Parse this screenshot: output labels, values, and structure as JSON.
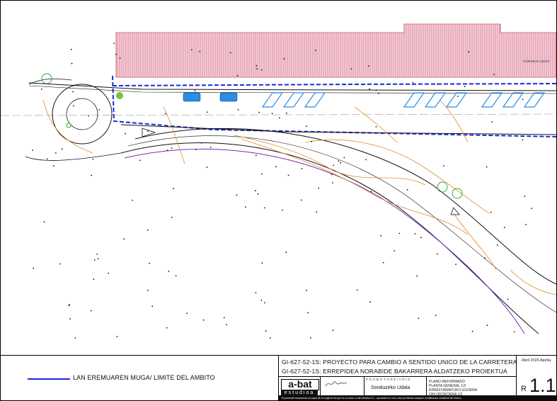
{
  "plan": {
    "building_label": "3 ERAIKIN AZKOT",
    "trees": [
      "tree",
      "tree",
      "tree",
      "tree",
      "tree"
    ]
  },
  "legend": {
    "label": "LAN EREMUAREN MUGA/ LIMITE DEL AMBITO",
    "line_color": "#1a2bd8"
  },
  "titleblock": {
    "title_es": "GI-627-52-1S: PROYECTO  PARA CAMBIO A SENTIDO UNICO DE LA CARRETERA",
    "title_eu": "GI-627-52-1S:  ERREPIDEA NORABIDE BAKARRERA ALDATZEKO  PROIEKTUA",
    "logo_main": "a-bat",
    "logo_sub": "estudioa",
    "promoter_header": "PROMOTORE/ARIO",
    "promoter": "Soraluzeko Udala",
    "description": [
      "PLANO REFORMADO",
      "PLANTA GENERAL 1/2",
      "ERREFORMATUKO EGOERA",
      "OIN OROKORRA 1/2"
    ],
    "date": "Abril 2026 Apirila",
    "revision": "R",
    "sheet": "1.1",
    "footer": "El presente documento es copia de su original del que es su autor a-bat estudioa S.L. quedando en todo caso prohibida cualquier modificacion unilateral del mismo"
  },
  "colors": {
    "building": "#d45a78",
    "boundary": "#1a2bd8",
    "parking": "#2a8ee8",
    "contour": "#e28a2a",
    "road_edge": "#7a2bb8"
  }
}
